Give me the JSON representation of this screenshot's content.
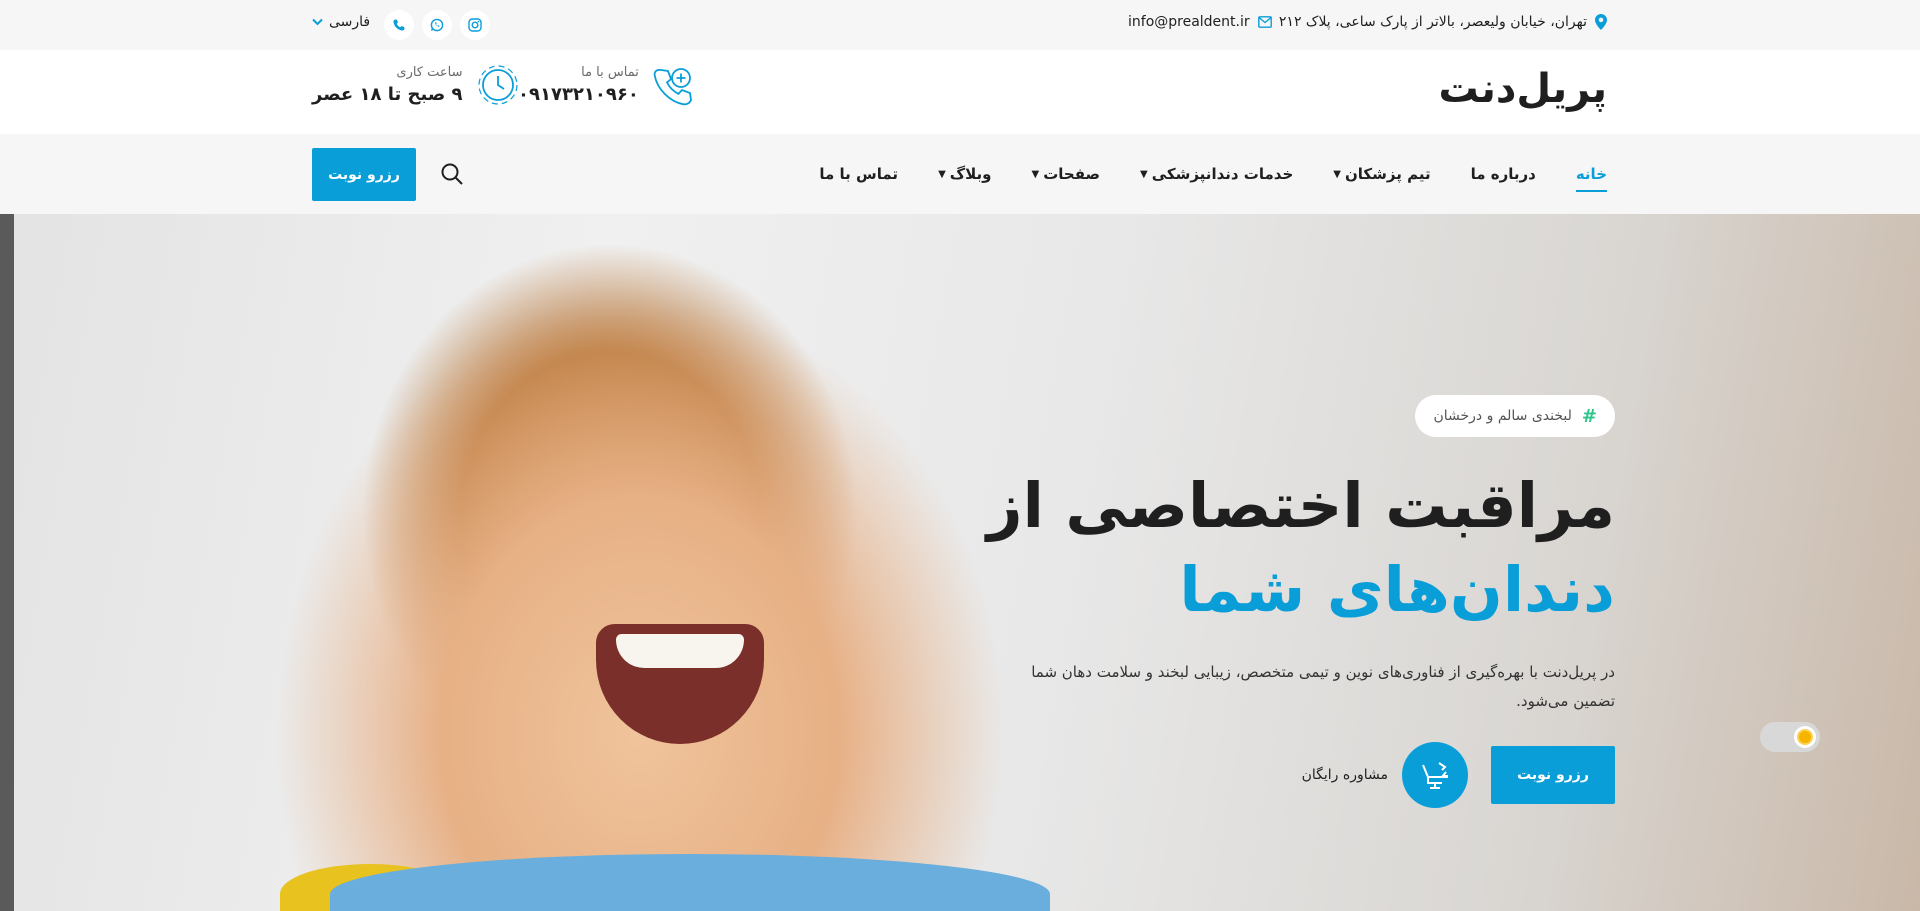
{
  "topbar": {
    "address": "تهران، خیابان ولیعصر، بالاتر از پارک ساعی، پلاک ۲۱۲",
    "email": "info@prealdent.ir",
    "language": "فارسی",
    "icons": [
      "location-pin-icon",
      "mail-icon",
      "instagram-icon",
      "whatsapp-icon",
      "viber-icon",
      "chevron-down-icon"
    ]
  },
  "header": {
    "logo": "پریل‌دنت",
    "contact_label": "تماس با ما",
    "contact_value": "۰۹۱۷۳۲۱۰۹۶۰",
    "hours_label": "ساعت کاری",
    "hours_value": "۹ صبح تا ۱۸ عصر"
  },
  "nav": {
    "items": [
      {
        "label": "خانه",
        "active": true,
        "dropdown": false
      },
      {
        "label": "درباره ما",
        "active": false,
        "dropdown": false
      },
      {
        "label": "تیم پزشکان",
        "active": false,
        "dropdown": true
      },
      {
        "label": "خدمات دندانپزشکی",
        "active": false,
        "dropdown": true
      },
      {
        "label": "صفحات",
        "active": false,
        "dropdown": true
      },
      {
        "label": "وبلاگ",
        "active": false,
        "dropdown": true
      },
      {
        "label": "تماس با ما",
        "active": false,
        "dropdown": false
      }
    ],
    "book_button": "رزرو نوبت"
  },
  "hero": {
    "tagline": "لبخندی سالم و درخشان",
    "tag_symbol": "#",
    "headline_line1": "مراقبت اختصاصی از",
    "headline_line2": "دندان‌های شما",
    "description": "در پریل‌دنت با بهره‌گیری از فناوری‌های نوین و تیمی متخصص، زیبایی لبخند و سلامت دهان شما تضمین می‌شود.",
    "cta_button": "رزرو نوبت",
    "consult_label": "مشاوره رایگان"
  },
  "colors": {
    "accent": "#0a9ed9",
    "topbar_bg": "#f6f6f6",
    "tag_hash": "#2fc48a",
    "text": "#1f1f1f"
  }
}
